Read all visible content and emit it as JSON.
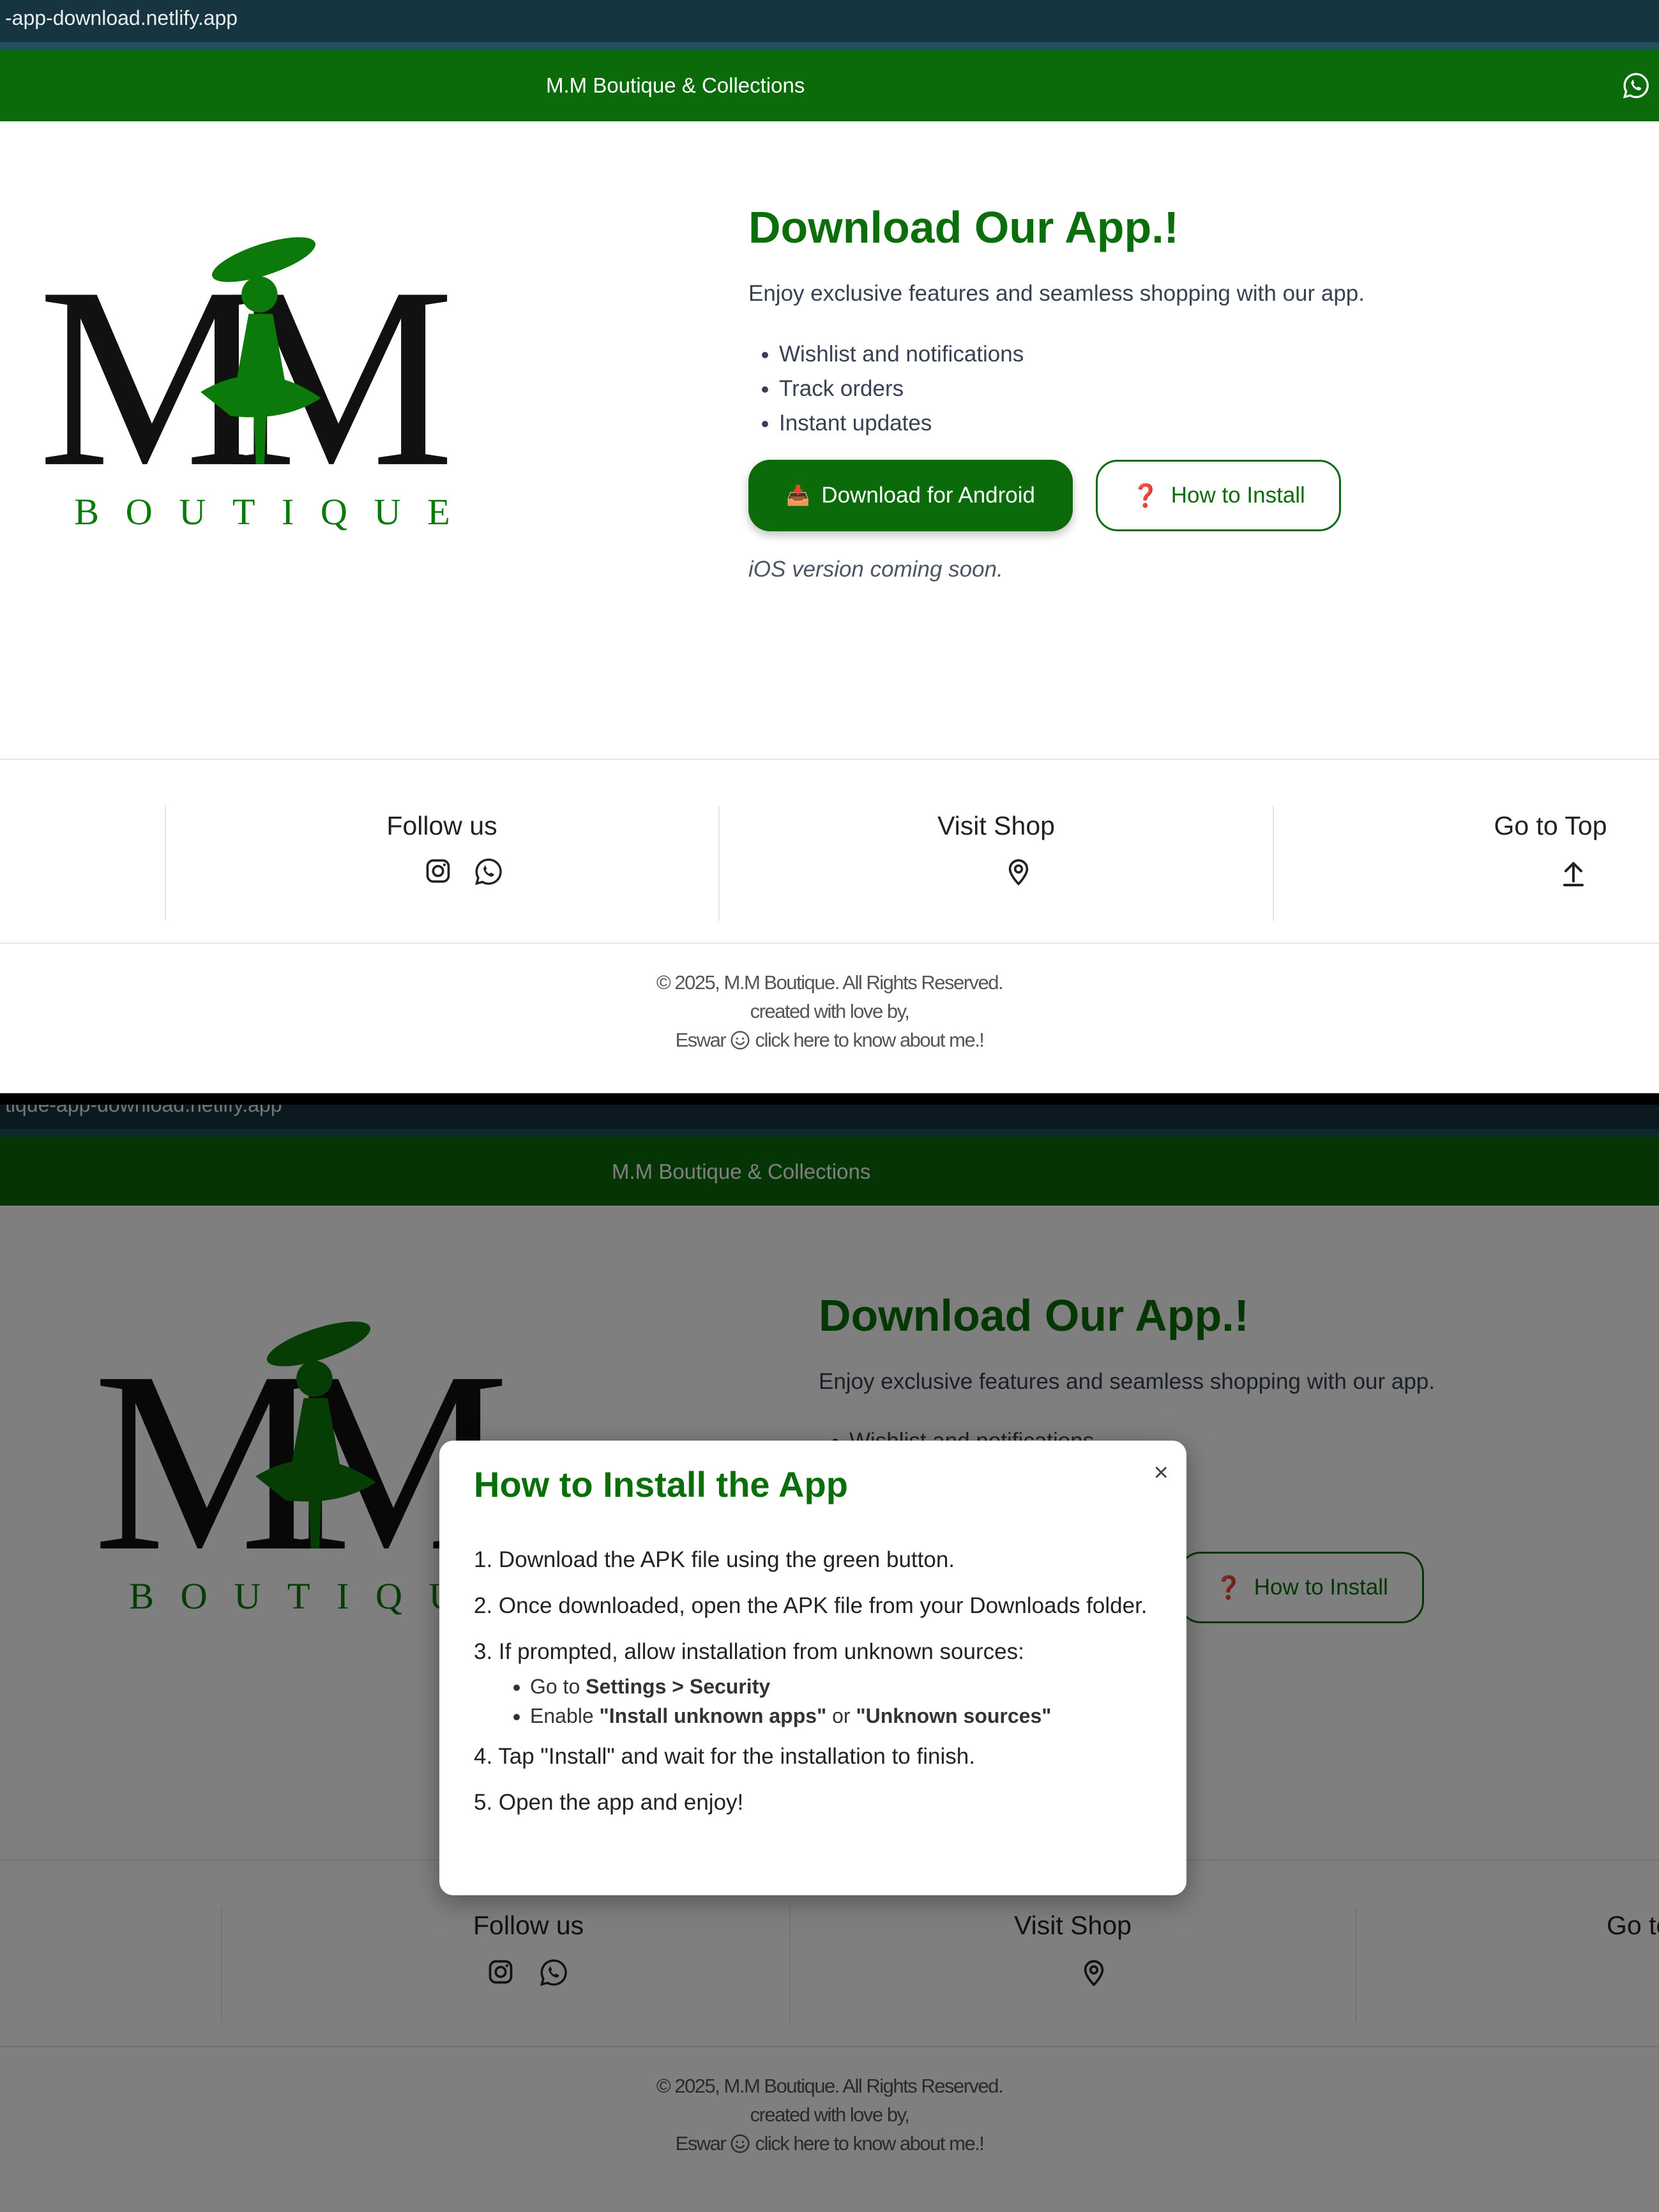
{
  "browser": {
    "url_top": "-app-download.netlify.app",
    "url_bottom": "tique-app-download.netlify.app"
  },
  "header": {
    "brand": "M.M Boutique & Collections",
    "whatsapp_icon": "whatsapp-icon"
  },
  "logo": {
    "monogram": "MM",
    "wordmark": "BOUTIQUE"
  },
  "hero": {
    "title": "Download Our App.!",
    "subtitle": "Enjoy exclusive features and seamless shopping with our app.",
    "features": [
      "Wishlist and notifications",
      "Track orders",
      "Instant updates"
    ],
    "download_button": "Download for Android",
    "download_icon": "📥",
    "install_button": "How to Install",
    "install_icon": "❓",
    "ios_note": "iOS version coming soon."
  },
  "footer": {
    "follow_label": "Follow us",
    "visit_label": "Visit Shop",
    "top_label": "Go to Top",
    "copyright": "© 2025, M.M Boutique. All Rights Reserved.",
    "created": "created with love by,",
    "author": "Eswar",
    "author_link": "click here to know about me.!"
  },
  "modal": {
    "title": "How to Install the App",
    "close": "×",
    "step1": "1. Download the APK file using the green button.",
    "step2": "2. Once downloaded, open the APK file from your Downloads folder.",
    "step3": "3. If prompted, allow installation from unknown sources:",
    "sub1_prefix": "Go to",
    "sub1_bold": "Settings > Security",
    "sub2_prefix": "Enable",
    "sub2_bold1": "\"Install unknown apps\"",
    "sub2_mid": "or",
    "sub2_bold2": "\"Unknown sources\"",
    "step4": "4. Tap \"Install\" and wait for the installation to finish.",
    "step5": "5. Open the app and enjoy!"
  },
  "colors": {
    "brand_green": "#0b6b0b",
    "title_green": "#0b6e0b",
    "url_bar": "#173541"
  }
}
